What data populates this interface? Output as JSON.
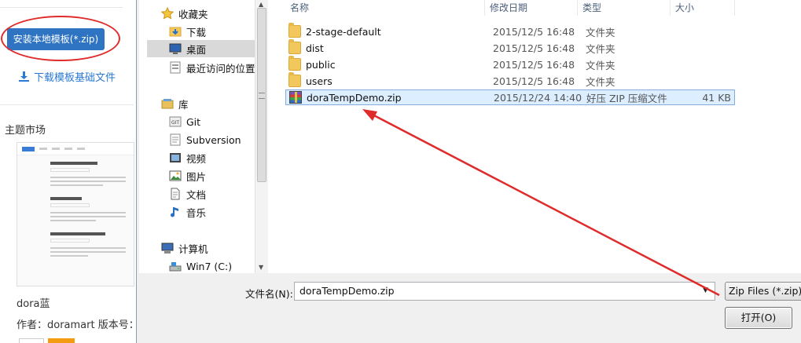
{
  "web": {
    "install_button": "安装本地模板(*.zip)",
    "download_link": "下载模板基础文件",
    "market_title": "主题市场",
    "theme_name": "dora蓝",
    "author_line": "作者：doramart 版本号："
  },
  "nav": {
    "items": [
      {
        "label": "收藏夹",
        "icon": "star-icon"
      },
      {
        "label": "下载",
        "icon": "download-folder-icon"
      },
      {
        "label": "桌面",
        "icon": "desktop-icon",
        "selected": true
      },
      {
        "label": "最近访问的位置",
        "icon": "recent-places-icon"
      },
      {
        "label": "库",
        "icon": "library-icon"
      },
      {
        "label": "Git",
        "icon": "git-icon"
      },
      {
        "label": "Subversion",
        "icon": "subversion-icon"
      },
      {
        "label": "视频",
        "icon": "video-icon"
      },
      {
        "label": "图片",
        "icon": "picture-icon"
      },
      {
        "label": "文档",
        "icon": "document-icon"
      },
      {
        "label": "音乐",
        "icon": "music-icon"
      },
      {
        "label": "计算机",
        "icon": "computer-icon"
      },
      {
        "label": "Win7 (C:)",
        "icon": "drive-icon"
      }
    ]
  },
  "columns": {
    "name": "名称",
    "date": "修改日期",
    "type": "类型",
    "size": "大小"
  },
  "files": [
    {
      "name": "2-stage-default",
      "date": "2015/12/5 16:48",
      "type": "文件夹",
      "size": "",
      "icon": "folder-icon"
    },
    {
      "name": "dist",
      "date": "2015/12/5 16:48",
      "type": "文件夹",
      "size": "",
      "icon": "folder-icon"
    },
    {
      "name": "public",
      "date": "2015/12/5 16:48",
      "type": "文件夹",
      "size": "",
      "icon": "folder-icon"
    },
    {
      "name": "users",
      "date": "2015/12/5 16:48",
      "type": "文件夹",
      "size": "",
      "icon": "folder-icon"
    },
    {
      "name": "doraTempDemo.zip",
      "date": "2015/12/24 14:40",
      "type": "好压 ZIP 压缩文件",
      "size": "41 KB",
      "icon": "zip-archive-icon",
      "selected": true
    }
  ],
  "bottom": {
    "filename_label": "文件名(N):",
    "filename_value": "doraTempDemo.zip",
    "filetype_value": "Zip Files (*.zip)",
    "open_button": "打开(O)"
  },
  "colors": {
    "highlight": "#e02b2b",
    "accent": "#2f74c2",
    "link": "#2a7ad4"
  }
}
